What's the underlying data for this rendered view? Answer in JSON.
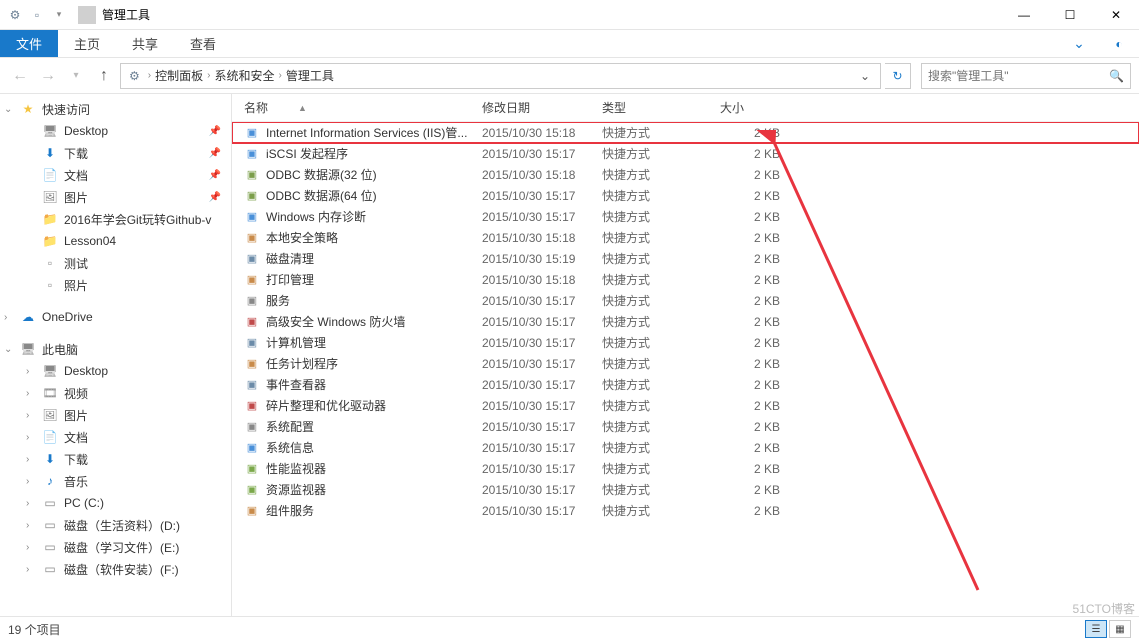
{
  "window": {
    "title": "管理工具"
  },
  "ribbon": {
    "file": "文件",
    "home": "主页",
    "share": "共享",
    "view": "查看"
  },
  "breadcrumb": {
    "seg1": "控制面板",
    "seg2": "系统和安全",
    "seg3": "管理工具"
  },
  "search": {
    "placeholder": "搜索\"管理工具\""
  },
  "sidebar": {
    "quick": "快速访问",
    "items_quick": [
      {
        "label": "Desktop",
        "icon": "desktop"
      },
      {
        "label": "下载",
        "icon": "download"
      },
      {
        "label": "文档",
        "icon": "doc"
      },
      {
        "label": "图片",
        "icon": "pic"
      },
      {
        "label": "2016年学会Git玩转Github-v",
        "icon": "folder"
      },
      {
        "label": "Lesson04",
        "icon": "folder"
      },
      {
        "label": "测试",
        "icon": "apple"
      },
      {
        "label": "照片",
        "icon": "apple"
      }
    ],
    "onedrive": "OneDrive",
    "thispc": "此电脑",
    "items_pc": [
      {
        "label": "Desktop",
        "icon": "desktop"
      },
      {
        "label": "视频",
        "icon": "video"
      },
      {
        "label": "图片",
        "icon": "pic"
      },
      {
        "label": "文档",
        "icon": "doc"
      },
      {
        "label": "下载",
        "icon": "download"
      },
      {
        "label": "音乐",
        "icon": "music"
      },
      {
        "label": "PC (C:)",
        "icon": "drive"
      },
      {
        "label": "磁盘（生活资料）(D:)",
        "icon": "drive"
      },
      {
        "label": "磁盘（学习文件）(E:)",
        "icon": "drive"
      },
      {
        "label": "磁盘（软件安装）(F:)",
        "icon": "drive"
      }
    ]
  },
  "columns": {
    "name": "名称",
    "date": "修改日期",
    "type": "类型",
    "size": "大小"
  },
  "files": [
    {
      "name": "Internet Information Services (IIS)管...",
      "date": "2015/10/30 15:18",
      "type": "快捷方式",
      "size": "2 KB",
      "hl": true
    },
    {
      "name": "iSCSI 发起程序",
      "date": "2015/10/30 15:17",
      "type": "快捷方式",
      "size": "2 KB"
    },
    {
      "name": "ODBC 数据源(32 位)",
      "date": "2015/10/30 15:18",
      "type": "快捷方式",
      "size": "2 KB"
    },
    {
      "name": "ODBC 数据源(64 位)",
      "date": "2015/10/30 15:17",
      "type": "快捷方式",
      "size": "2 KB"
    },
    {
      "name": "Windows 内存诊断",
      "date": "2015/10/30 15:17",
      "type": "快捷方式",
      "size": "2 KB"
    },
    {
      "name": "本地安全策略",
      "date": "2015/10/30 15:18",
      "type": "快捷方式",
      "size": "2 KB"
    },
    {
      "name": "磁盘清理",
      "date": "2015/10/30 15:19",
      "type": "快捷方式",
      "size": "2 KB"
    },
    {
      "name": "打印管理",
      "date": "2015/10/30 15:18",
      "type": "快捷方式",
      "size": "2 KB"
    },
    {
      "name": "服务",
      "date": "2015/10/30 15:17",
      "type": "快捷方式",
      "size": "2 KB"
    },
    {
      "name": "高级安全 Windows 防火墙",
      "date": "2015/10/30 15:17",
      "type": "快捷方式",
      "size": "2 KB"
    },
    {
      "name": "计算机管理",
      "date": "2015/10/30 15:17",
      "type": "快捷方式",
      "size": "2 KB"
    },
    {
      "name": "任务计划程序",
      "date": "2015/10/30 15:17",
      "type": "快捷方式",
      "size": "2 KB"
    },
    {
      "name": "事件查看器",
      "date": "2015/10/30 15:17",
      "type": "快捷方式",
      "size": "2 KB"
    },
    {
      "name": "碎片整理和优化驱动器",
      "date": "2015/10/30 15:17",
      "type": "快捷方式",
      "size": "2 KB"
    },
    {
      "name": "系统配置",
      "date": "2015/10/30 15:17",
      "type": "快捷方式",
      "size": "2 KB"
    },
    {
      "name": "系统信息",
      "date": "2015/10/30 15:17",
      "type": "快捷方式",
      "size": "2 KB"
    },
    {
      "name": "性能监视器",
      "date": "2015/10/30 15:17",
      "type": "快捷方式",
      "size": "2 KB"
    },
    {
      "name": "资源监视器",
      "date": "2015/10/30 15:17",
      "type": "快捷方式",
      "size": "2 KB"
    },
    {
      "name": "组件服务",
      "date": "2015/10/30 15:17",
      "type": "快捷方式",
      "size": "2 KB"
    }
  ],
  "status": {
    "count": "19 个项目"
  },
  "watermark": "51CTO博客"
}
